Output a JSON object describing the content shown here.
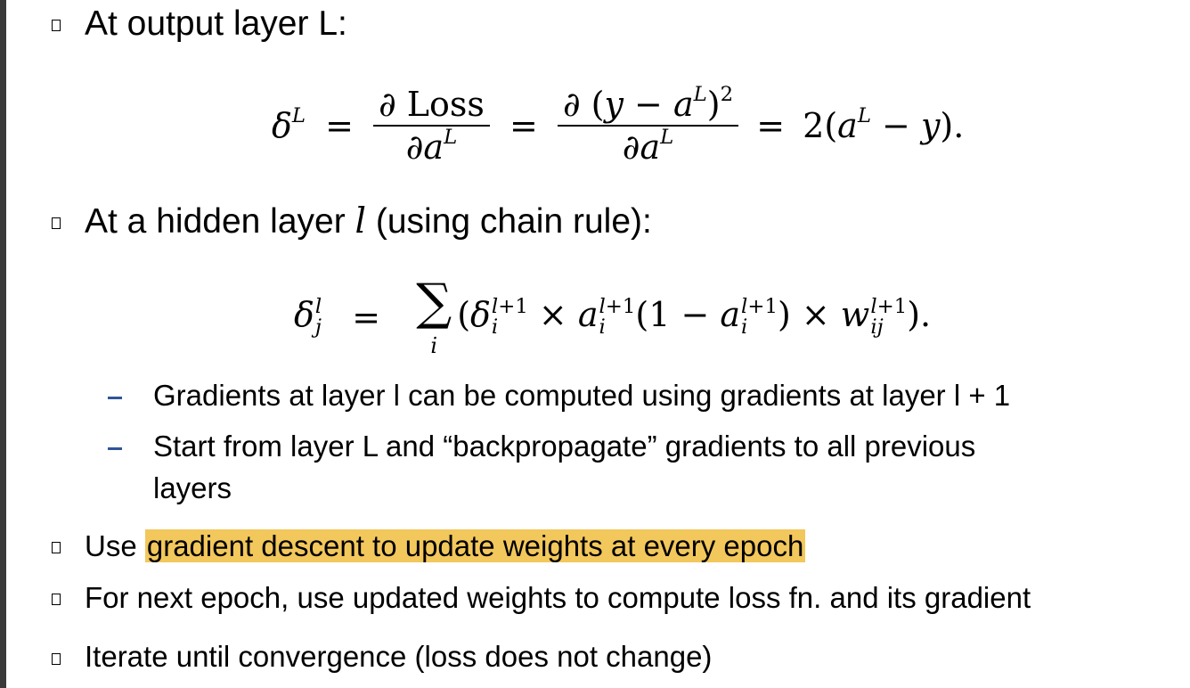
{
  "bullets": {
    "output_layer": "At output layer L:",
    "hidden_layer_prefix": "At a hidden layer ",
    "hidden_layer_var": "l",
    "hidden_layer_suffix": " (using chain rule):",
    "use_prefix": "Use ",
    "use_highlight": "gradient descent to update weights at every epoch",
    "next_epoch": "For next epoch, use updated weights to compute loss fn. and its gradient",
    "iterate": "Iterate until convergence (loss does not change)"
  },
  "sub_bullets": [
    "Gradients at layer l can be computed using gradients at layer l + 1",
    "Start from layer L and “backpropagate” gradients to all previous",
    "layers"
  ],
  "colors": {
    "highlight": "#f2c75c",
    "dash": "#2f5597",
    "left_rule": "#3a3a3a"
  }
}
